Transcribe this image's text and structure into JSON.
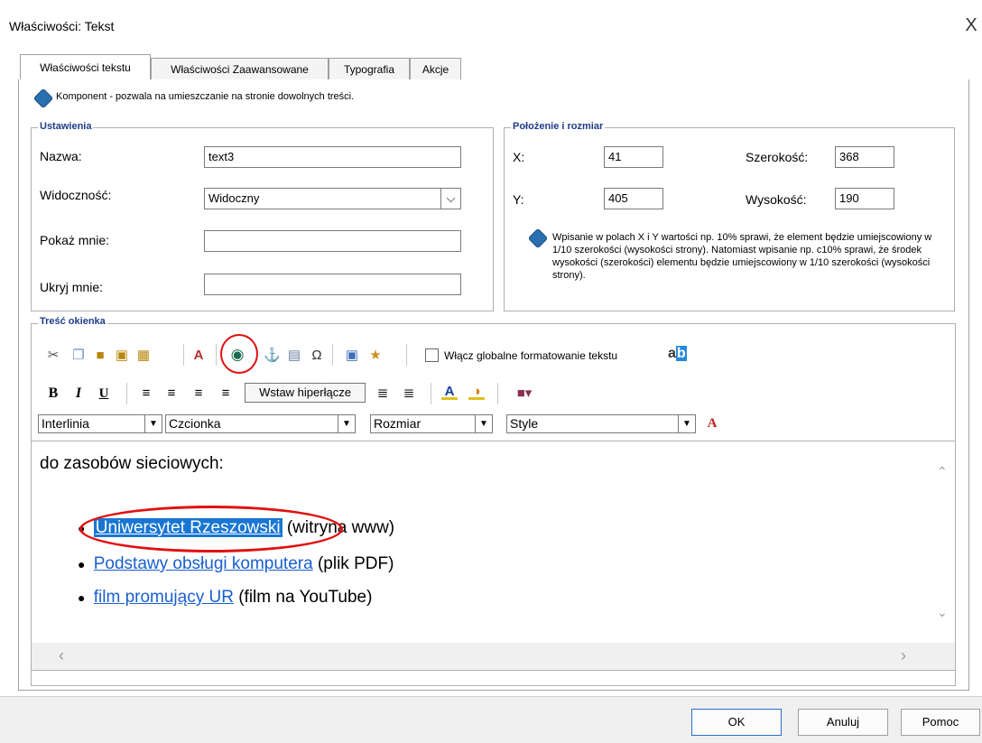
{
  "window": {
    "title": "Właściwości: Tekst",
    "close_glyph": "X"
  },
  "tabs": [
    "Właściwości tekstu",
    "Właściwości Zaawansowane",
    "Typografia",
    "Akcje"
  ],
  "hint_component": "Komponent - pozwala na umieszczanie na stronie dowolnych treści.",
  "settings": {
    "group_label": "Ustawienia",
    "name_label": "Nazwa:",
    "name_value": "text3",
    "visibility_label": "Widoczność:",
    "visibility_value": "Widoczny",
    "show_label": "Pokaż mnie:",
    "show_value": "",
    "hide_label": "Ukryj mnie:",
    "hide_value": ""
  },
  "position": {
    "group_label": "Położenie i rozmiar",
    "x_label": "X:",
    "x_value": "41",
    "y_label": "Y:",
    "y_value": "405",
    "width_label": "Szerokość:",
    "width_value": "368",
    "height_label": "Wysokość:",
    "height_value": "190",
    "hint": "Wpisanie w polach X i Y wartości np. 10% sprawi, że element będzie umiejscowiony w 1/10 szerokości (wysokości strony). Natomiast wpisanie np. c10% sprawi, że środek wysokości (szerokości) elementu będzie umiejscowiony w 1/10 szerokości (wysokości strony)."
  },
  "content": {
    "group_label": "Treść okienka",
    "global_format_label": "Włącz globalne formatowanie tekstu",
    "global_format_checked": false,
    "tooltip": "Wstaw hiperłącze",
    "combos": {
      "line_height": "Interlinia",
      "font": "Czcionka",
      "size": "Rozmiar",
      "style": "Style"
    },
    "editor": {
      "heading": "do zasobów sieciowych:",
      "items": [
        {
          "link": "Uniwersytet Rzeszowski",
          "suffix": "(witryna www)"
        },
        {
          "link": "Podstawy obsługi komputera",
          "suffix": "(plik PDF)"
        },
        {
          "link": "film promujący UR",
          "suffix": "(film na YouTube)"
        }
      ]
    }
  },
  "buttons": {
    "ok": "OK",
    "cancel": "Anuluj",
    "help": "Pomoc"
  },
  "icons": [
    "cut-icon",
    "copy-icon",
    "paste-icon",
    "paste-text-icon",
    "paste-word-icon",
    "spellcheck-icon",
    "hyperlink-icon",
    "anchor-icon",
    "unlink-icon",
    "special-char-icon",
    "image-icon",
    "media-icon",
    "bold-icon",
    "italic-icon",
    "underline-icon",
    "align-left-icon",
    "align-center-icon",
    "align-right-icon",
    "justify-icon",
    "ordered-list-icon",
    "bullet-list-icon",
    "font-color-icon",
    "highlight-color-icon",
    "insert-object-icon",
    "clear-format-icon",
    "highlight-toggle-icon"
  ],
  "colors": {
    "link": "#1a5fd0",
    "highlight": "#1976d2",
    "group_label": "#1e3c8a",
    "annotation_red": "#e01010"
  }
}
